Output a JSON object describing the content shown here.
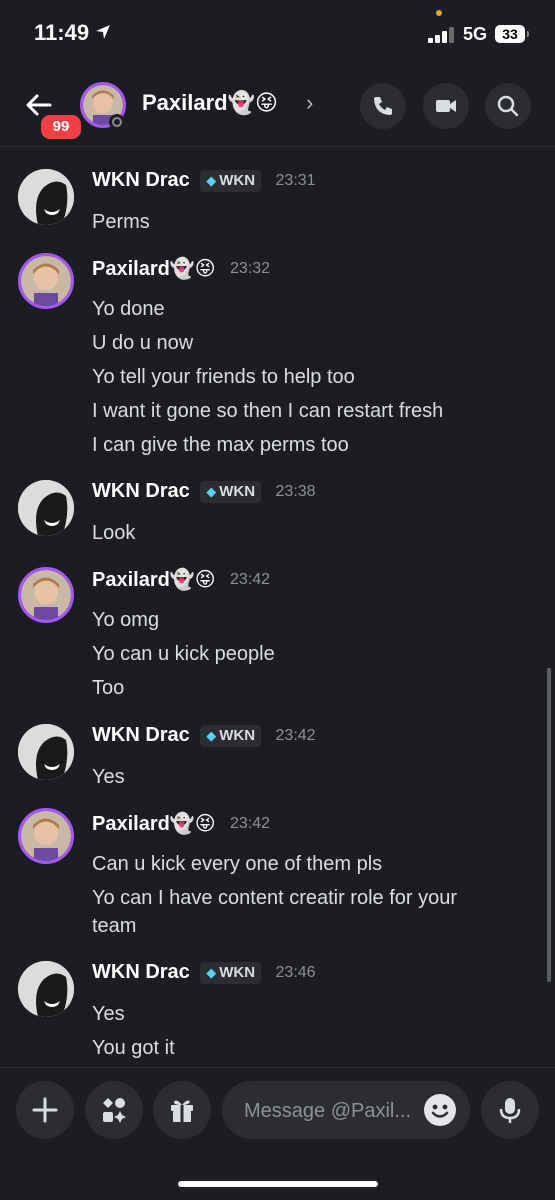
{
  "status_bar": {
    "time": "11:49",
    "network": "5G",
    "battery": "33"
  },
  "header": {
    "unread_badge": "99",
    "title": "Paxilard👻😝",
    "chevron": "›"
  },
  "composer": {
    "placeholder": "Message @Paxil..."
  },
  "messages": [
    {
      "author": "WKN Drac",
      "tag": "WKN",
      "time": "23:31",
      "lines": [
        "Perms"
      ]
    },
    {
      "author": "Paxilard👻😝",
      "time": "23:32",
      "lines": [
        "Yo done",
        "U do u now",
        "Yo tell your friends to help too",
        "I want it gone so then I can restart fresh",
        "I can give the max perms too"
      ]
    },
    {
      "author": "WKN Drac",
      "tag": "WKN",
      "time": "23:38",
      "lines": [
        "Look"
      ]
    },
    {
      "author": "Paxilard👻😝",
      "time": "23:42",
      "lines": [
        "Yo omg",
        "Yo can u kick people",
        "Too"
      ]
    },
    {
      "author": "WKN Drac",
      "tag": "WKN",
      "time": "23:42",
      "lines": [
        "Yes"
      ]
    },
    {
      "author": "Paxilard👻😝",
      "time": "23:42",
      "lines": [
        "Can u kick every one of them pls",
        "Yo can I have content creatir role for your",
        "team"
      ]
    },
    {
      "author": "WKN Drac",
      "tag": "WKN",
      "time": "23:46",
      "lines": [
        "Yes",
        "You got it"
      ]
    }
  ],
  "icons": {
    "back": "arrow-left-icon",
    "call": "phone-icon",
    "video": "video-camera-icon",
    "search": "search-icon",
    "plus": "plus-icon",
    "apps": "apps-icon",
    "gift": "gift-icon",
    "emoji": "emoji-icon",
    "mic": "microphone-icon",
    "tag_gem": "diamond-icon"
  },
  "colors": {
    "background": "#1c1d22",
    "accent": "#a855f7",
    "badge": "#f23f43",
    "gem": "#5ad0f5"
  }
}
